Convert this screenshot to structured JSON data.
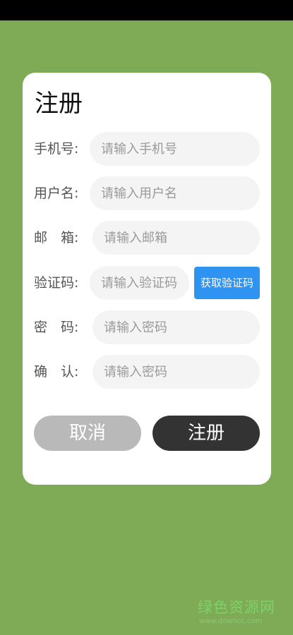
{
  "colors": {
    "background": "#7fab56",
    "status_bar": "#000000",
    "card": "#ffffff",
    "code_button": "#2f93f2",
    "cancel_button": "#b9b9b9",
    "submit_button": "#333333"
  },
  "form": {
    "title": "注册",
    "fields": [
      {
        "label": "手机号:",
        "placeholder": "请输入手机号"
      },
      {
        "label": "用户名:",
        "placeholder": "请输入用户名"
      },
      {
        "label": "邮　箱:",
        "placeholder": "请输入邮箱"
      },
      {
        "label": "验证码:",
        "placeholder": "请输入验证码"
      },
      {
        "label": "密　码:",
        "placeholder": "请输入密码"
      },
      {
        "label": "确　认:",
        "placeholder": "请输入密码"
      }
    ],
    "get_code_label": "获取验证码",
    "cancel_label": "取消",
    "submit_label": "注册"
  },
  "watermark": {
    "main": "绿色资源网",
    "sub": "www.downcc.com"
  }
}
